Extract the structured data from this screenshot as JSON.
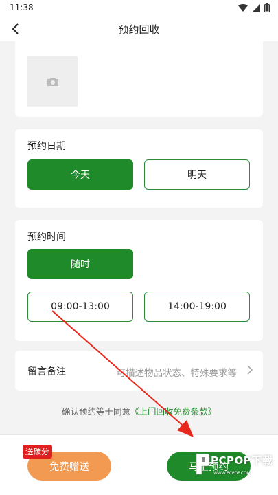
{
  "status_bar": {
    "time": "11:38",
    "icons": [
      "wifi-icon",
      "signal-icon",
      "battery-icon"
    ]
  },
  "app_bar": {
    "title": "预约回收",
    "back_icon": "chevron-left-icon"
  },
  "photo_section": {
    "icon": "camera-icon"
  },
  "date_section": {
    "title": "预约日期",
    "options": [
      {
        "label": "今天",
        "selected": true
      },
      {
        "label": "明天",
        "selected": false
      }
    ]
  },
  "time_section": {
    "title": "预约时间",
    "options": [
      {
        "label": "随时",
        "selected": true
      },
      {
        "label": "09:00-13:00",
        "selected": false
      },
      {
        "label": "14:00-19:00",
        "selected": false
      }
    ]
  },
  "note_section": {
    "label": "留言备注",
    "placeholder": "可描述物品状态、特殊要求等",
    "arrow_icon": "chevron-right-icon"
  },
  "agreement": {
    "prefix": "确认预约等于同意",
    "link": "《上门回收免费条款》"
  },
  "bottom_bar": {
    "donate_label": "免费赠送",
    "carbon_badge": "送碳分",
    "reserve_label": "马上预约"
  },
  "watermark": {
    "brand": "PCPOP下载",
    "sub": "WWW.PCPOP.COM"
  },
  "colors": {
    "primary_green": "#1f8a2a",
    "donate_orange": "#f39a52",
    "badge_red": "#e02020",
    "annotation_red": "#e8281d"
  }
}
